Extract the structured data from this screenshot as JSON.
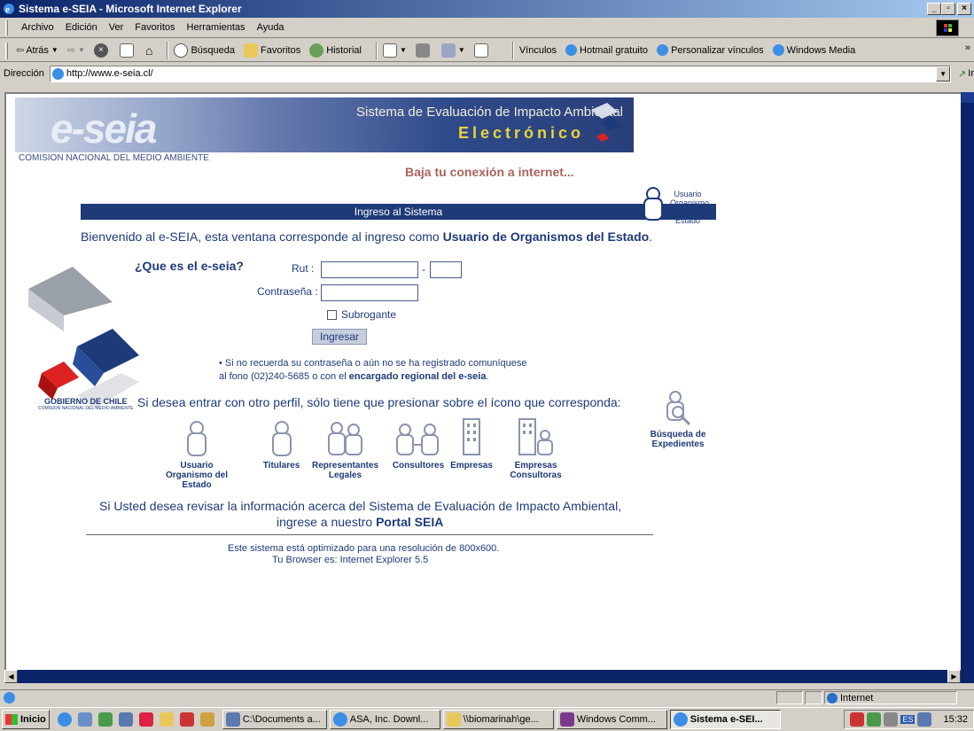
{
  "window": {
    "title": "Sistema e-SEIA - Microsoft Internet Explorer"
  },
  "menu": [
    "Archivo",
    "Edición",
    "Ver",
    "Favoritos",
    "Herramientas",
    "Ayuda"
  ],
  "toolbar": {
    "back": "Atrás",
    "search": "Búsqueda",
    "favorites": "Favoritos",
    "history": "Historial",
    "links_label": "Vínculos",
    "link1": "Hotmail gratuito",
    "link2": "Personalizar vínculos",
    "link3": "Windows Media"
  },
  "address": {
    "label": "Dirección",
    "url": "http://www.e-seia.cl/",
    "go": "Ir"
  },
  "page": {
    "banner_title": "Sistema de Evaluación de Impacto Ambiental",
    "banner_sub": "Electrónico",
    "banner_logo": "e-seia",
    "conama": "COMISION NACIONAL DEL MEDIO AMBIENTE",
    "baja": "Baja tu conexión a internet...",
    "ingreso": "Ingreso al Sistema",
    "usuario_top": "Usuario Organismo del Estado",
    "welcome_pre": "Bienvenido al e-SEIA, esta ventana corresponde al ingreso como ",
    "welcome_bold": "Usuario de Organismos del Estado",
    "welcome_post": ".",
    "que_es": "¿Que es el e-seia?",
    "rut_label": "Rut :",
    "rut_dash": "-",
    "pass_label": "Contraseña :",
    "subrogante": "Subrogante",
    "ingresar": "Ingresar",
    "note1": "•  Si no recuerda su contraseña o aún no se ha registrado comuníquese",
    "note2_pre": "al fono (02)240-5685 o con el ",
    "note2_bold": "encargado regional del e-seia",
    "note2_post": ".",
    "otro_perfil": "Si desea entrar con otro perfil, sólo tiene que presionar sobre el ícono que corresponda:",
    "gobierno": "GOBIERNO DE CHILE",
    "gobierno_sub": "COMISION NACIONAL DEL MEDIO AMBIENTE",
    "profiles": [
      {
        "label": "Usuario Organismo del Estado"
      },
      {
        "label": "Titulares"
      },
      {
        "label": "Representantes Legales"
      },
      {
        "label": "Consultores"
      },
      {
        "label": "Empresas"
      },
      {
        "label": "Empresas Consultoras"
      },
      {
        "label": "Búsqueda de Expedientes"
      }
    ],
    "portal_line1": "Si Usted desea revisar la información acerca del Sistema de Evaluación de Impacto Ambiental,",
    "portal_line2_pre": "ingrese a nuestro ",
    "portal_line2_bold": "Portal SEIA",
    "optimized": "Este sistema está optimizado para una resolución de 800x600.",
    "browser": "Tu Browser es: Internet Explorer 5.5"
  },
  "status": {
    "zone": "Internet"
  },
  "taskbar": {
    "start": "Inicio",
    "tasks": [
      "C:\\Documents a...",
      "ASA, Inc. Downl...",
      "\\\\biomarinah\\ge...",
      "Windows Comm...",
      "Sistema e-SEI..."
    ],
    "lang": "ES",
    "clock": "15:32"
  },
  "colors": {
    "title_bar": "#0a246a",
    "page_blue": "#1e3a78",
    "baja": "#a8645c"
  }
}
